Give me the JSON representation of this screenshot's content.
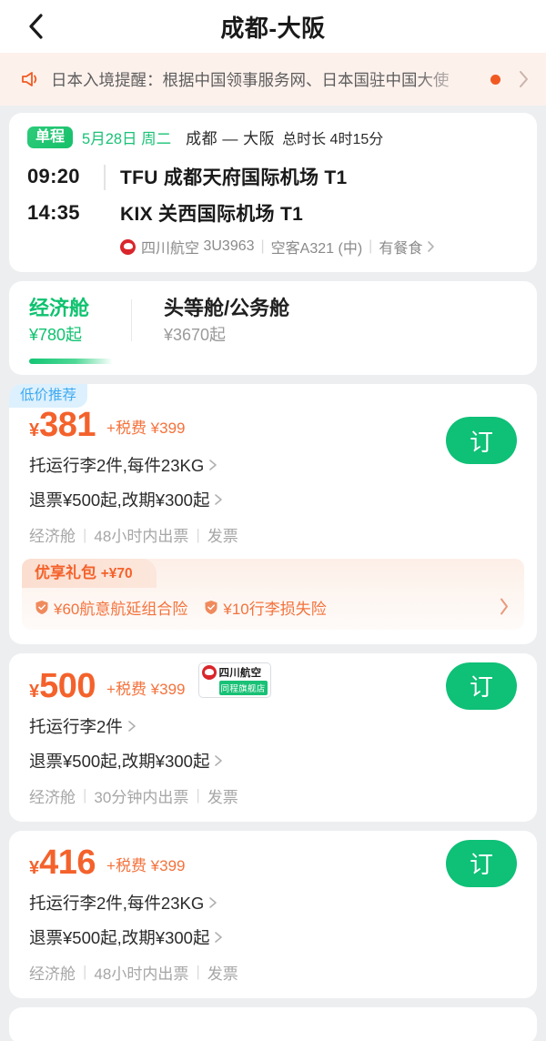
{
  "nav": {
    "back_icon": "chevron-left-icon",
    "title": "成都-大阪"
  },
  "notice": {
    "horn_icon": "megaphone-icon",
    "text": "日本入境提醒：根据中国领事服务网、日本国驻中国大使",
    "dot_color": "#f05a22",
    "arrow_icon": "chevron-right-icon"
  },
  "flight": {
    "trip_type": "单程",
    "date": "5月28日 周二",
    "cities": "成都 — 大阪",
    "duration": "总时长 4时15分",
    "segments": [
      {
        "time": "09:20",
        "airport": "TFU 成都天府国际机场 T1"
      },
      {
        "time": "14:35",
        "airport": "KIX 关西国际机场 T1"
      }
    ],
    "airline": {
      "logo_icon": "sichuan-airlines-logo-icon",
      "name": "四川航空",
      "flight_no": "3U3963",
      "aircraft": "空客A321 (中)",
      "meal": "有餐食",
      "arrow_icon": "chevron-right-icon"
    }
  },
  "cabins": [
    {
      "name": "经济舱",
      "price": "¥780起",
      "active": true
    },
    {
      "name": "头等舱/公务舱",
      "price": "¥3670起",
      "active": false
    }
  ],
  "colors": {
    "brand_green": "#0fc077",
    "price_orange": "#f4622c",
    "tag_blue_bg": "#ddf0fd",
    "tag_blue_text": "#3eaaf0",
    "page_bg": "#eceef0"
  },
  "fares": [
    {
      "tag": "低价推荐",
      "currency": "¥",
      "price": "381",
      "tax": "+税费 ¥399",
      "badge": null,
      "baggage": "托运行李2件,每件23KG",
      "refund": "退票¥500起,改期¥300起",
      "meta": [
        "经济舱",
        "48小时内出票",
        "发票"
      ],
      "order_label": "订",
      "gift": {
        "title": "优享礼包",
        "amount": "+¥70",
        "items": [
          "¥60航意航延组合险",
          "¥10行李损失险"
        ],
        "arrow_icon": "chevron-right-icon"
      }
    },
    {
      "tag": null,
      "currency": "¥",
      "price": "500",
      "tax": "+税费 ¥399",
      "badge": {
        "name": "四川航空",
        "sub": "同程旗舰店",
        "logo_icon": "sichuan-airlines-logo-icon"
      },
      "baggage": "托运行李2件",
      "refund": "退票¥500起,改期¥300起",
      "meta": [
        "经济舱",
        "30分钟内出票",
        "发票"
      ],
      "order_label": "订",
      "gift": null
    },
    {
      "tag": null,
      "currency": "¥",
      "price": "416",
      "tax": "+税费 ¥399",
      "badge": null,
      "baggage": "托运行李2件,每件23KG",
      "refund": "退票¥500起,改期¥300起",
      "meta": [
        "经济舱",
        "48小时内出票",
        "发票"
      ],
      "order_label": "订",
      "gift": null
    }
  ]
}
